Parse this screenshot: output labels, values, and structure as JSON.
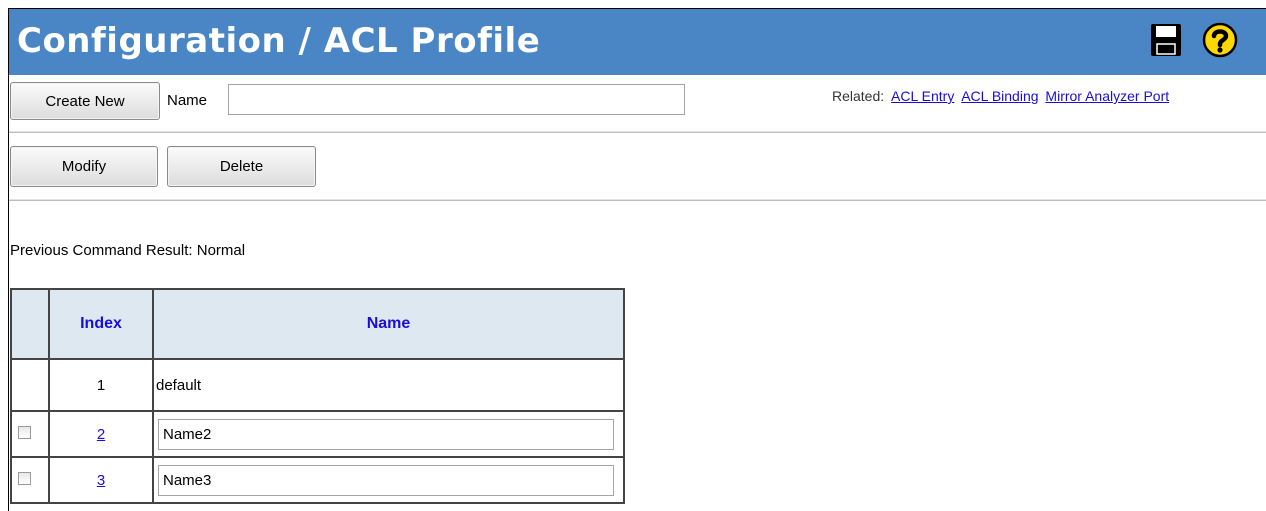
{
  "header": {
    "title": "Configuration / ACL Profile",
    "icons": [
      "save-icon",
      "help-icon"
    ],
    "color": "#4a86c5"
  },
  "create": {
    "button_label": "Create New",
    "name_label": "Name",
    "name_value": ""
  },
  "related": {
    "label": "Related:",
    "links": [
      "ACL Entry",
      "ACL Binding",
      "Mirror Analyzer Port"
    ]
  },
  "actions": {
    "modify_label": "Modify",
    "delete_label": "Delete"
  },
  "status": {
    "text": "Previous Command Result: Normal"
  },
  "table": {
    "columns": [
      "",
      "Index",
      "Name"
    ],
    "rows": [
      {
        "index": "1",
        "name": "default",
        "editable": false
      },
      {
        "index": "2",
        "name": "Name2",
        "editable": true
      },
      {
        "index": "3",
        "name": "Name3",
        "editable": true
      }
    ]
  }
}
